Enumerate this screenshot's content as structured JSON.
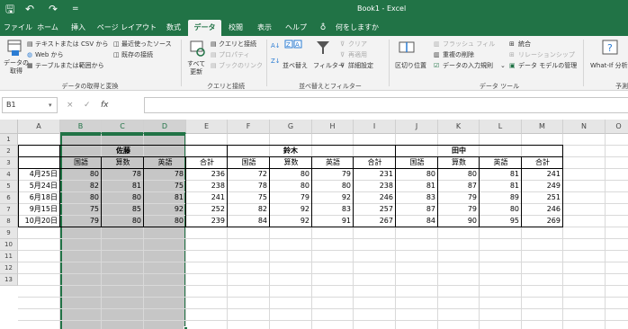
{
  "window": {
    "title": "Book1 - Excel"
  },
  "quick_access": {
    "save": "🖫",
    "undo": "↶",
    "redo": "↷",
    "customize": "="
  },
  "tabs": [
    "ファイル",
    "ホーム",
    "挿入",
    "ページ レイアウト",
    "数式",
    "データ",
    "校閲",
    "表示",
    "ヘルプ",
    "何をしますか"
  ],
  "ribbon": {
    "get_data": "データの\n取得",
    "from_text_csv": "テキストまたは CSV から",
    "from_web": "Web から",
    "from_table": "テーブルまたは範囲から",
    "recent_sources": "最近使ったソース",
    "existing_connections": "既存の接続",
    "group_get_transform": "データの取得と変換",
    "refresh_all": "すべて\n更新",
    "queries_connections": "クエリと接続",
    "properties": "プロパティ",
    "edit_links": "ブックのリンク",
    "group_queries": "クエリと接続",
    "sort": "並べ替え",
    "filter": "フィルター",
    "clear": "クリア",
    "reapply": "再適用",
    "advanced": "詳細設定",
    "group_sort_filter": "並べ替えとフィルター",
    "text_to_columns": "区切り位置",
    "flash_fill": "フラッシュ フィル",
    "remove_duplicates": "重複の削除",
    "data_validation": "データの入力規則",
    "consolidate": "統合",
    "relationships": "リレーションシップ",
    "data_model": "データ モデルの管理",
    "group_data_tools": "データ ツール",
    "what_if": "What-If 分析",
    "group_forecast": "予測"
  },
  "formula_bar": {
    "name_box": "B1",
    "cancel": "×",
    "enter": "✓",
    "fx": "fx",
    "value": ""
  },
  "columns": [
    "A",
    "B",
    "C",
    "D",
    "E",
    "F",
    "G",
    "H",
    "I",
    "J",
    "K",
    "L",
    "M",
    "N",
    "O"
  ],
  "rows": [
    "1",
    "2",
    "3",
    "4",
    "5",
    "6",
    "7",
    "8",
    "9",
    "10",
    "11",
    "12",
    "13"
  ],
  "table": {
    "groups": [
      "佐藤",
      "鈴木",
      "田中"
    ],
    "subheaders": [
      "国語",
      "算数",
      "英語",
      "合計",
      "国語",
      "算数",
      "英語",
      "合計",
      "国語",
      "算数",
      "英語",
      "合計"
    ],
    "records": [
      {
        "date": "4月25日",
        "values": [
          "80",
          "78",
          "78",
          "236",
          "72",
          "80",
          "79",
          "231",
          "80",
          "80",
          "81",
          "241"
        ]
      },
      {
        "date": "5月24日",
        "values": [
          "82",
          "81",
          "75",
          "238",
          "78",
          "80",
          "80",
          "238",
          "81",
          "87",
          "81",
          "249"
        ]
      },
      {
        "date": "6月18日",
        "values": [
          "80",
          "80",
          "81",
          "241",
          "75",
          "79",
          "92",
          "246",
          "83",
          "79",
          "89",
          "251"
        ]
      },
      {
        "date": "9月15日",
        "values": [
          "75",
          "85",
          "92",
          "252",
          "82",
          "92",
          "83",
          "257",
          "87",
          "79",
          "80",
          "246"
        ]
      },
      {
        "date": "10月20日",
        "values": [
          "79",
          "80",
          "80",
          "239",
          "84",
          "92",
          "91",
          "267",
          "84",
          "90",
          "95",
          "269"
        ]
      }
    ]
  },
  "colors": {
    "accent": "#217346",
    "selection": "#c6c6c6"
  }
}
